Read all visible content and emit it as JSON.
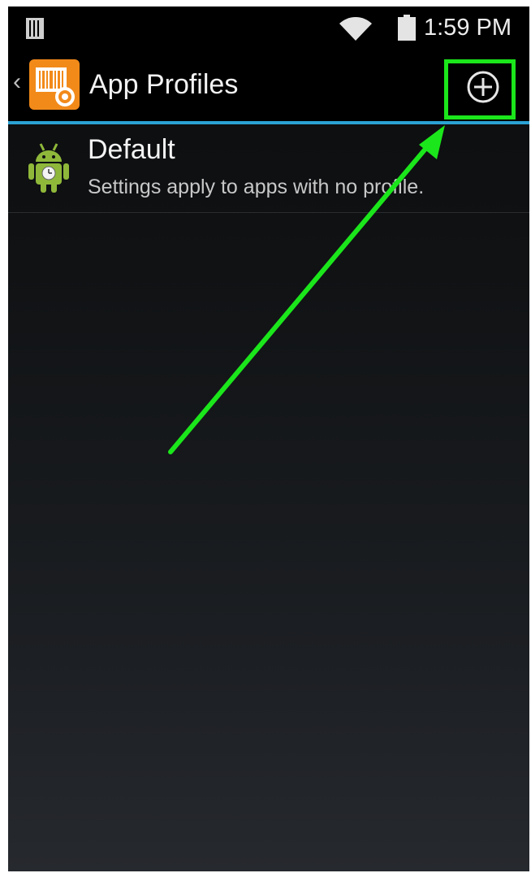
{
  "status_bar": {
    "time": "1:59 PM",
    "icons": [
      "sim-card-icon",
      "wifi-icon",
      "battery-icon"
    ]
  },
  "action_bar": {
    "back_glyph": "‹",
    "title": "App Profiles",
    "app_icon": "barcode-settings-icon",
    "add_button_icon": "add-circle-icon",
    "accent_color": "#2ba2d4"
  },
  "profiles": [
    {
      "title": "Default",
      "subtitle": "Settings apply to apps with no profile.",
      "icon": "android-icon"
    }
  ],
  "annotation": {
    "highlight_color": "#1be61b",
    "arrow_target": "add-button"
  }
}
